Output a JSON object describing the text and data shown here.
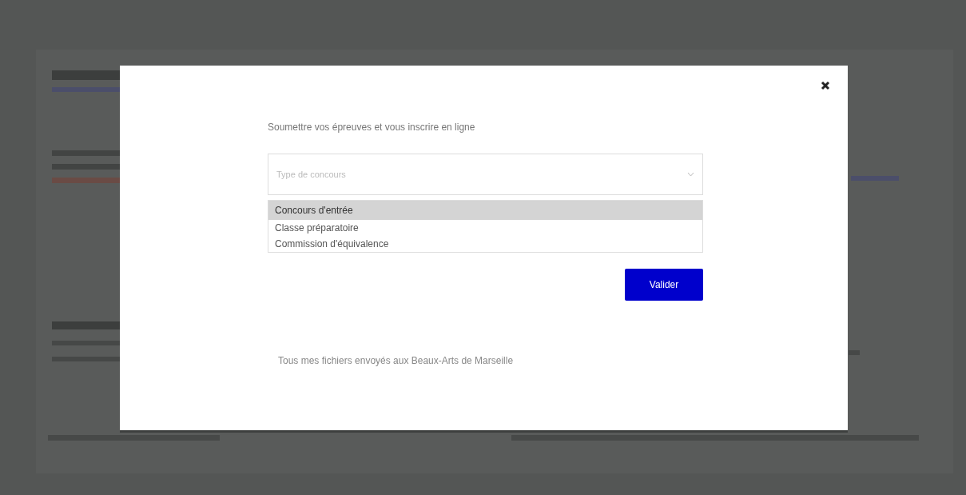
{
  "modal": {
    "heading": "Soumettre vos épreuves et vous inscrire en ligne",
    "select": {
      "placeholder": "Type de concours",
      "expanded": true
    },
    "options": [
      {
        "label": "Concours d'entrée",
        "selected": true
      },
      {
        "label": "Classe préparatoire",
        "selected": false
      },
      {
        "label": "Commission d'équivalence",
        "selected": false
      }
    ],
    "submit": "Valider",
    "footer_link": "Tous mes fichiers envoyés aux Beaux-Arts de Marseille"
  }
}
